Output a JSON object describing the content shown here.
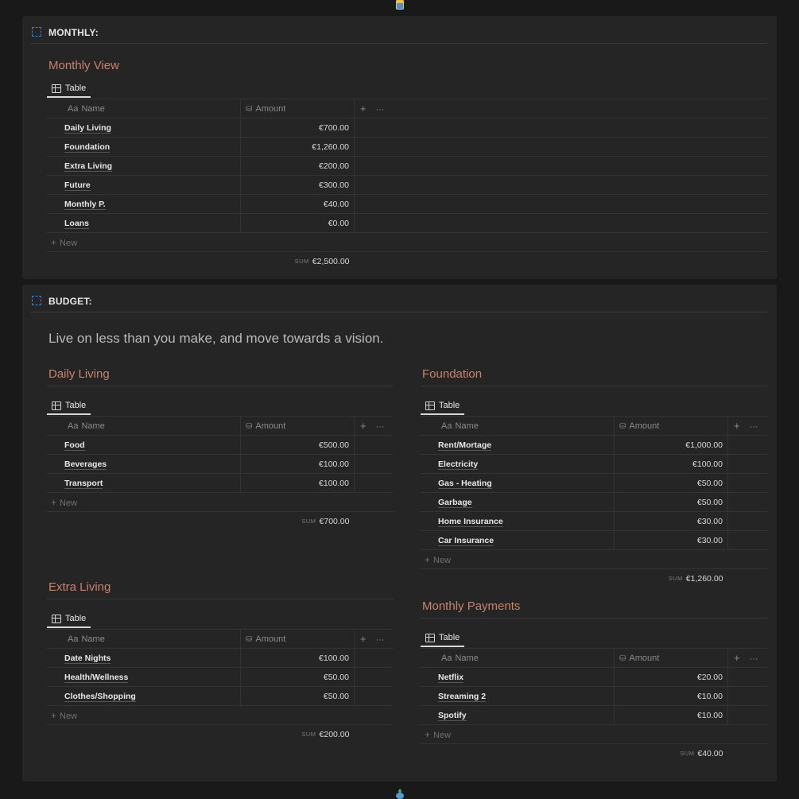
{
  "monthly": {
    "title": "MONTHLY:",
    "section_title": "Monthly View",
    "tab": "Table",
    "columns": {
      "name_prefix": "Aa",
      "name": "Name",
      "amount": "Amount"
    },
    "rows": [
      {
        "name": "Daily Living",
        "amount": "€700.00"
      },
      {
        "name": "Foundation",
        "amount": "€1,260.00"
      },
      {
        "name": "Extra Living",
        "amount": "€200.00"
      },
      {
        "name": "Future",
        "amount": "€300.00"
      },
      {
        "name": "Monthly P.",
        "amount": "€40.00"
      },
      {
        "name": "Loans",
        "amount": "€0.00"
      }
    ],
    "new_label": "New",
    "sum_label": "SUM",
    "sum_value": "€2,500.00"
  },
  "budget": {
    "title": "BUDGET:",
    "quote": "Live on less than you make, and move towards a vision.",
    "daily_living": {
      "title": "Daily Living",
      "tab": "Table",
      "rows": [
        {
          "name": "Food",
          "amount": "€500.00"
        },
        {
          "name": "Beverages",
          "amount": "€100.00"
        },
        {
          "name": "Transport",
          "amount": "€100.00"
        }
      ],
      "sum_value": "€700.00"
    },
    "foundation": {
      "title": "Foundation",
      "tab": "Table",
      "rows": [
        {
          "name": "Rent/Mortage",
          "amount": "€1,000.00"
        },
        {
          "name": "Electricity",
          "amount": "€100.00"
        },
        {
          "name": "Gas - Heating",
          "amount": "€50.00"
        },
        {
          "name": "Garbage",
          "amount": "€50.00"
        },
        {
          "name": "Home Insurance",
          "amount": "€30.00"
        },
        {
          "name": "Car Insurance",
          "amount": "€30.00"
        }
      ],
      "sum_value": "€1,260.00"
    },
    "extra_living": {
      "title": "Extra Living",
      "tab": "Table",
      "rows": [
        {
          "name": "Date Nights",
          "amount": "€100.00"
        },
        {
          "name": "Health/Wellness",
          "amount": "€50.00"
        },
        {
          "name": "Clothes/Shopping",
          "amount": "€50.00"
        }
      ],
      "sum_value": "€200.00"
    },
    "monthly_payments": {
      "title": "Monthly Payments",
      "tab": "Table",
      "rows": [
        {
          "name": "Netflix",
          "amount": "€20.00"
        },
        {
          "name": "Streaming 2",
          "amount": "€10.00"
        },
        {
          "name": "Spotify",
          "amount": "€10.00"
        }
      ],
      "sum_value": "€40.00"
    }
  },
  "colors": {
    "background": "#191919",
    "panel": "#252525",
    "section_title": "#c8826a",
    "checkbox": "#3b82d6"
  },
  "icons": {
    "top": "calendar-emoji-icon",
    "bottom": "plant-emoji-icon"
  }
}
